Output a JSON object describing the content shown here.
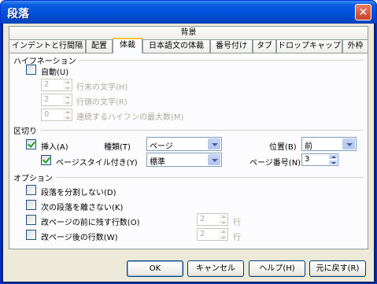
{
  "window": {
    "title": "段落",
    "close_glyph": "✕"
  },
  "tabs_row1": [
    {
      "label": "背景"
    }
  ],
  "tabs_row2": [
    {
      "label": "インデントと行間隔"
    },
    {
      "label": "配置"
    },
    {
      "label": "体裁",
      "active": true
    },
    {
      "label": "日本語文の体裁"
    },
    {
      "label": "番号付け"
    },
    {
      "label": "タブ"
    },
    {
      "label": "ドロップキャップ"
    },
    {
      "label": "外枠"
    }
  ],
  "hyphenation": {
    "title": "ハイフネーション",
    "auto": {
      "label": "自動(U)",
      "checked": false
    },
    "chars_at_line_end": {
      "label": "行末の文字(H)",
      "value": "2"
    },
    "chars_at_line_start": {
      "label": "行頭の文字(R)",
      "value": "2"
    },
    "max_consecutive": {
      "label": "連続するハイフンの最大数(M)",
      "value": "0"
    }
  },
  "breaks": {
    "title": "区切り",
    "insert": {
      "label": "挿入(A)",
      "checked": true
    },
    "type_label": "種類(T)",
    "type_value": "ページ",
    "position_label": "位置(B)",
    "position_value": "前",
    "with_page_style": {
      "label": "ページスタイル付き(Y)",
      "checked": true
    },
    "page_style_value": "標準",
    "page_number_label": "ページ番号(N)",
    "page_number_value": "3"
  },
  "options": {
    "title": "オプション",
    "no_split": {
      "label": "段落を分割しない(D)",
      "checked": false
    },
    "keep_with_next": {
      "label": "次の段落を離さない(K)",
      "checked": false
    },
    "orphan": {
      "label": "改ページの前に残す行数(O)",
      "checked": false,
      "value": "2",
      "unit": "行"
    },
    "widow": {
      "label": "改ページ後の行数(W)",
      "checked": false,
      "value": "2",
      "unit": "行"
    }
  },
  "buttons": {
    "ok": "OK",
    "cancel": "キャンセル",
    "help": "ヘルプ(H)",
    "reset": "元に戻す(R)"
  }
}
